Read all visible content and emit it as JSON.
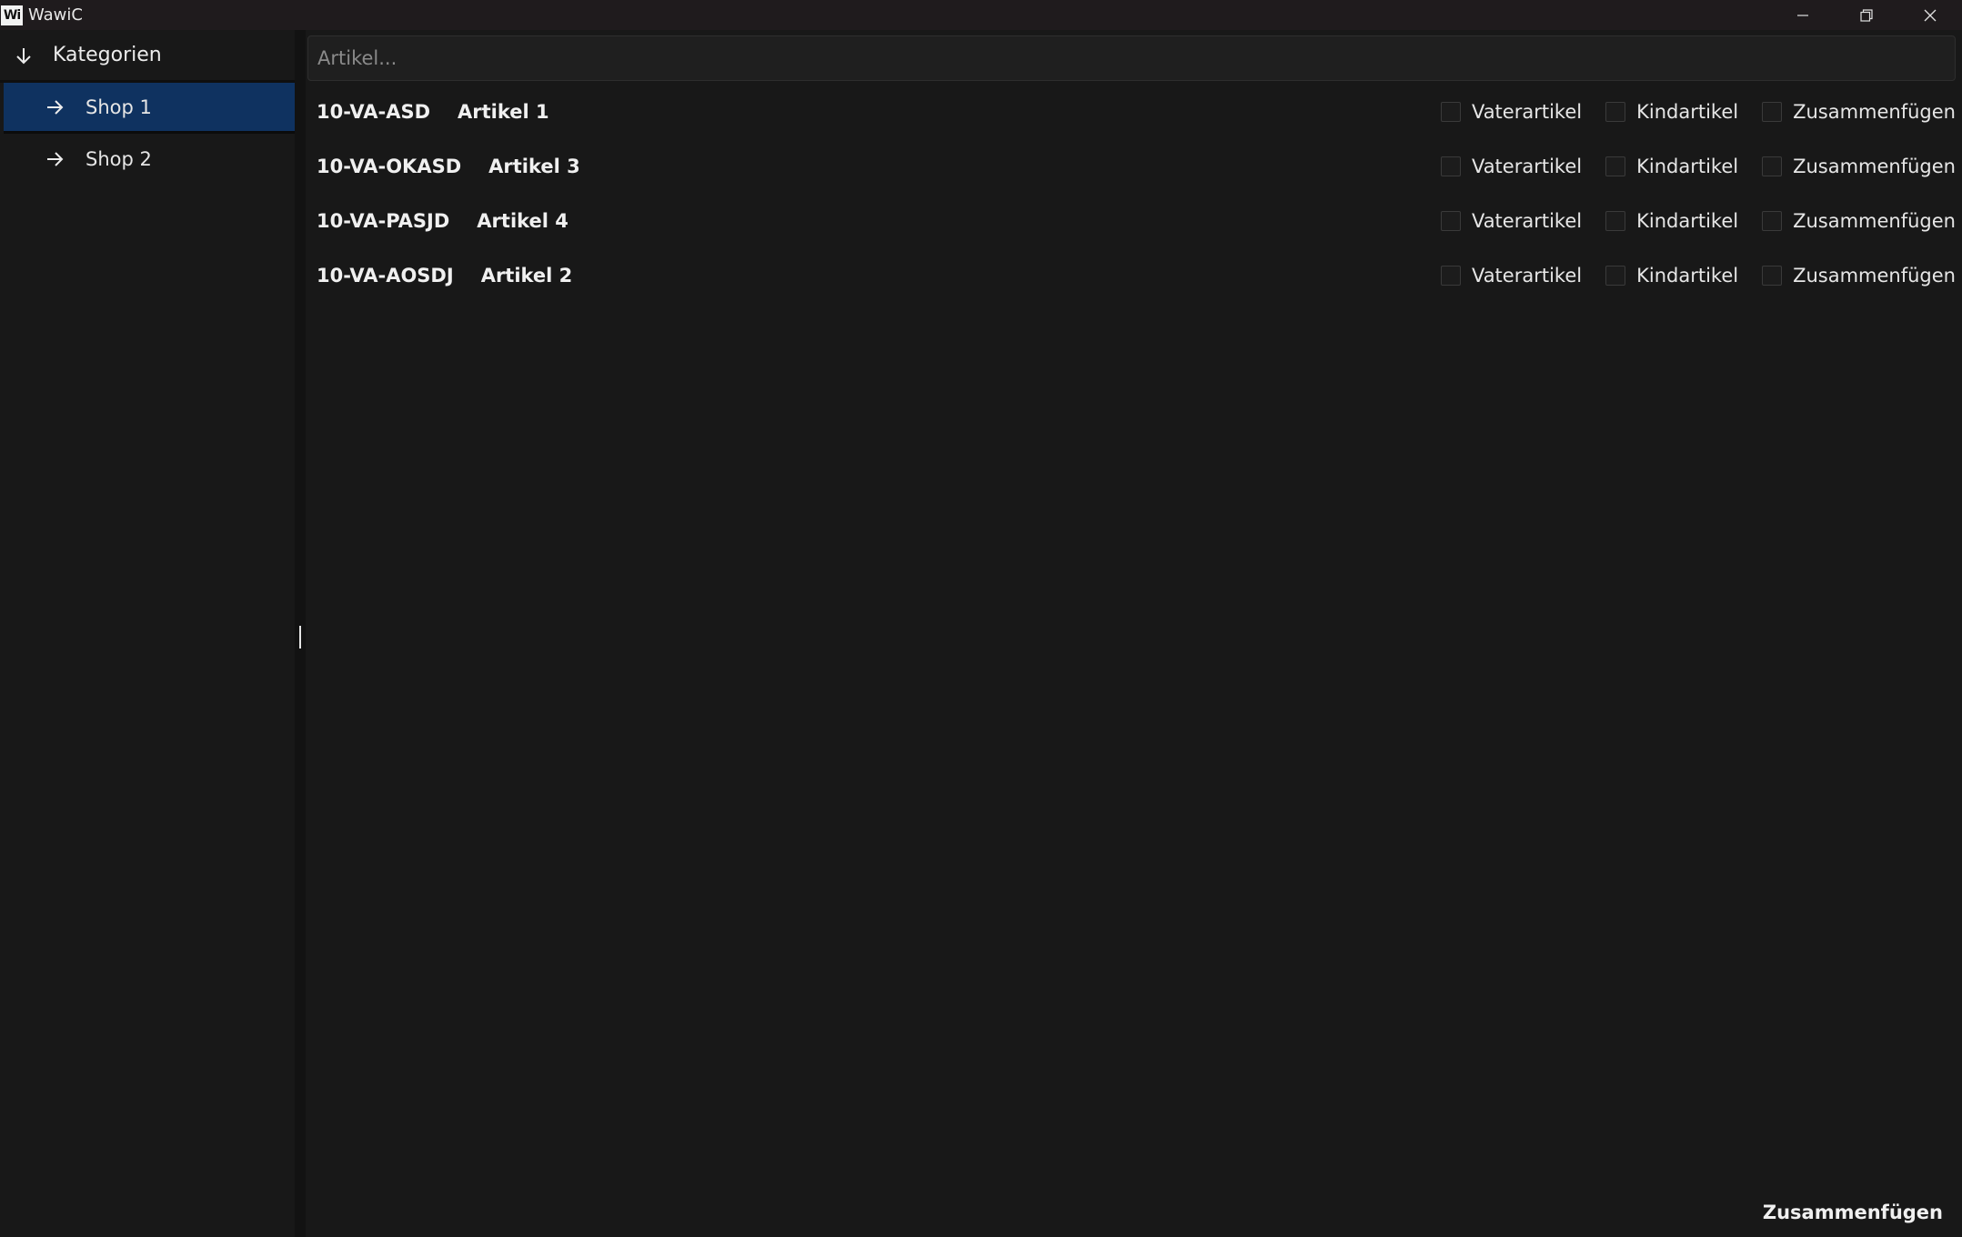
{
  "window": {
    "logo_text": "Wi",
    "title": "WawiC",
    "controls": [
      "minimize-icon",
      "restore-icon",
      "close-icon"
    ]
  },
  "sidebar": {
    "header": {
      "label": "Kategorien",
      "icon": "arrow-down-icon"
    },
    "items": [
      {
        "label": "Shop 1",
        "icon": "arrow-right-icon",
        "selected": true
      },
      {
        "label": "Shop 2",
        "icon": "arrow-right-icon",
        "selected": false
      }
    ]
  },
  "search": {
    "placeholder": "Artikel...",
    "value": ""
  },
  "articles": [
    {
      "sku": "10-VA-ASD",
      "name": "Artikel 1"
    },
    {
      "sku": "10-VA-OKASD",
      "name": "Artikel 3"
    },
    {
      "sku": "10-VA-PASJD",
      "name": "Artikel 4"
    },
    {
      "sku": "10-VA-AOSDJ",
      "name": "Artikel 2"
    }
  ],
  "checkbox_labels": {
    "parent": "Vaterartikel",
    "child": "Kindartikel",
    "merge": "Zusammenfügen"
  },
  "footer": {
    "merge_button": "Zusammenfügen"
  },
  "colors": {
    "background": "#181818",
    "titlebar": "#1f1b1d",
    "selected_item": "#0f3260",
    "text": "#ececec"
  }
}
